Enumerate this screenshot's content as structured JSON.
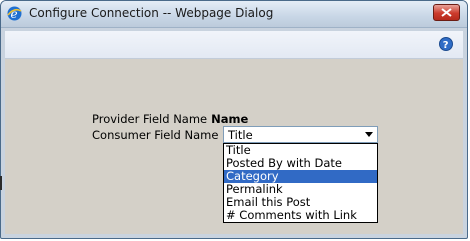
{
  "window": {
    "title": "Configure Connection -- Webpage Dialog"
  },
  "icons": {
    "app": "ie-icon",
    "close": "close-icon",
    "help": "help-icon",
    "dropdown_arrow": "chevron-down-icon"
  },
  "form": {
    "provider_label": "Provider Field Name",
    "provider_value": "Name",
    "consumer_label": "Consumer Field Name",
    "consumer_selected": "Title",
    "options": [
      "Title",
      "Posted By with Date",
      "Category",
      "Permalink",
      "Email this Post",
      "# Comments with Link"
    ],
    "highlighted_index": 2
  },
  "colors": {
    "close_button": "#cc3b2c",
    "highlight": "#316ac5",
    "content_bg": "#d4d0c8"
  }
}
